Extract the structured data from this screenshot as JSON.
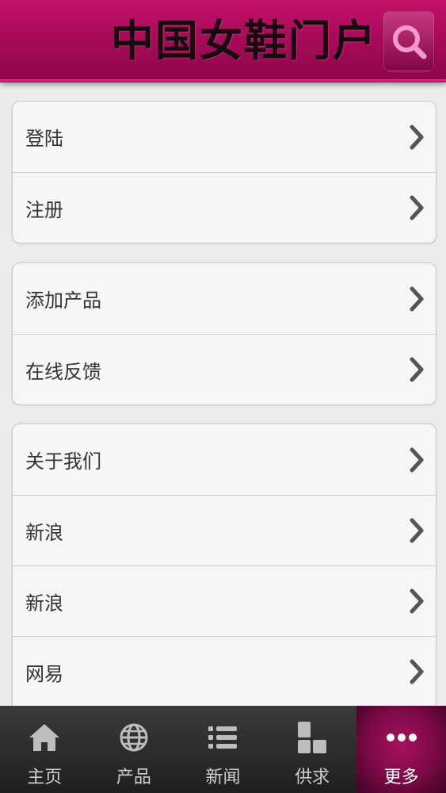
{
  "header": {
    "title": "中国女鞋门户",
    "search_icon": "search-icon"
  },
  "groups": [
    {
      "rows": [
        {
          "label": "登陆"
        },
        {
          "label": "注册"
        }
      ]
    },
    {
      "rows": [
        {
          "label": "添加产品"
        },
        {
          "label": "在线反馈"
        }
      ]
    },
    {
      "rows": [
        {
          "label": "关于我们"
        },
        {
          "label": "新浪"
        },
        {
          "label": "新浪"
        },
        {
          "label": "网易"
        }
      ]
    }
  ],
  "tabbar": {
    "tabs": [
      {
        "label": "主页",
        "icon": "home-icon"
      },
      {
        "label": "产品",
        "icon": "globe-icon"
      },
      {
        "label": "新闻",
        "icon": "list-icon"
      },
      {
        "label": "供求",
        "icon": "blocks-icon"
      },
      {
        "label": "更多",
        "icon": "more-icon"
      }
    ],
    "active_index": 4
  },
  "colors": {
    "brand": "#a40a57",
    "search_icon": "#f39ac8",
    "tab_icon": "#bdbdbd"
  }
}
